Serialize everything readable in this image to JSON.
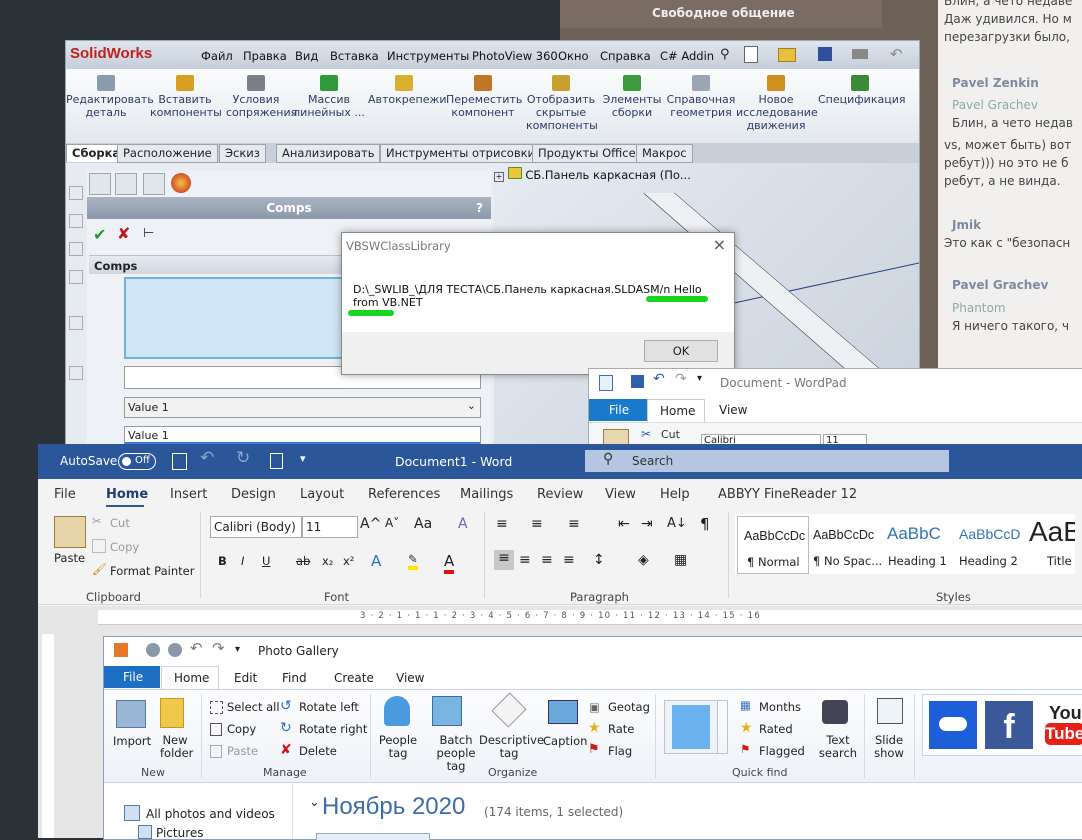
{
  "telegram": {
    "top_text": "Свободное общение",
    "lines": [
      "Блин, а чето недаве",
      "Даж удивился. Но м",
      "перезагрузки было,",
      "Pavel Zenkin",
      "Pavel Grachev",
      "Блин, а чето недав",
      "vs, может быть) вот",
      "ребут))) но это не б",
      "ребут, а не винда.",
      "Jmik",
      "Это как с \"безопасн",
      "Pavel Grachev",
      "Phantom",
      "Я ничего такого, ч"
    ]
  },
  "solidworks": {
    "logo": "SolidWorks",
    "menu": [
      "Файл",
      "Правка",
      "Вид",
      "Вставка",
      "Инструменты",
      "PhotoView 360",
      "Окно",
      "Справка",
      "C# Addin"
    ],
    "ribbon": [
      {
        "label": "Редактировать деталь",
        "color": "#8a9bb0"
      },
      {
        "label": "Вставить компоненты",
        "color": "#d7a020"
      },
      {
        "label": "Условия сопряжения",
        "color": "#7a8088"
      },
      {
        "label": "Массив линейных ...",
        "color": "#2f9a3a"
      },
      {
        "label": "Автокрепежи",
        "color": "#d9b030"
      },
      {
        "label": "Переместить компонент",
        "color": "#c07828"
      },
      {
        "label": "Отобразить скрытые компоненты",
        "color": "#c8a030"
      },
      {
        "label": "Элементы сборки",
        "color": "#3d9a3d"
      },
      {
        "label": "Справочная геометрия",
        "color": "#9aa6b6"
      },
      {
        "label": "Новое исследование движения",
        "color": "#d09020"
      },
      {
        "label": "Спецификация",
        "color": "#3a8a3a"
      }
    ],
    "tabs": [
      "Сборка",
      "Расположение",
      "Эскиз",
      "Анализировать",
      "Инструменты отрисовки",
      "Продукты Office",
      "Макрос"
    ],
    "panel_title": "Comps",
    "section": "Comps",
    "select_value": "Value 1",
    "list_item": "Value 1",
    "tree_item": "СБ.Панель каркасная  (По..."
  },
  "dialog": {
    "title": "VBSWClassLibrary",
    "message": "D:\\_SWLIB_\\ДЛЯ ТЕСТА\\СБ.Панель каркасная.SLDASM/n Hello from VB.NET",
    "ok": "OK"
  },
  "wordpad": {
    "title": "Document - WordPad",
    "tabs": [
      "File",
      "Home",
      "View"
    ],
    "font": "Calibri",
    "size": "11",
    "cut": "Cut"
  },
  "word": {
    "autosave": "AutoSave",
    "autosave_state": "Off",
    "title": "Document1 - Word",
    "search": "Search",
    "tabs": [
      "File",
      "Home",
      "Insert",
      "Design",
      "Layout",
      "References",
      "Mailings",
      "Review",
      "View",
      "Help",
      "ABBYY FineReader 12"
    ],
    "clipboard": {
      "paste": "Paste",
      "cut": "Cut",
      "copy": "Copy",
      "format_painter": "Format Painter",
      "group": "Clipboard"
    },
    "font": {
      "name": "Calibri (Body)",
      "size": "11",
      "group": "Font"
    },
    "paragraph_group": "Paragraph",
    "styles_group": "Styles",
    "styles": [
      {
        "preview": "AaBbCcDc",
        "name": "¶ Normal"
      },
      {
        "preview": "AaBbCcDc",
        "name": "¶ No Spac..."
      },
      {
        "preview": "AaBbC",
        "name": "Heading 1"
      },
      {
        "preview": "AaBbCcD",
        "name": "Heading 2"
      },
      {
        "preview": "AaB",
        "name": "Title"
      }
    ],
    "ruler": "3 · 2 · 1 · 1 · 1 · 2 · 3 · 4 · 5 · 6 · 7 · 8 · 9 · 10 · 11 · 12 · 13 · 14 · 15 · 16"
  },
  "photo_gallery": {
    "title": "Photo Gallery",
    "tabs": [
      "File",
      "Home",
      "Edit",
      "Find",
      "Create",
      "View"
    ],
    "new": {
      "import": "Import",
      "new_folder": "New folder",
      "group": "New"
    },
    "manage": {
      "select_all": "Select all",
      "copy": "Copy",
      "paste": "Paste",
      "rotate_left": "Rotate left",
      "rotate_right": "Rotate right",
      "delete": "Delete",
      "group": "Manage"
    },
    "organize": {
      "people_tag": "People tag",
      "batch": "Batch people tag",
      "descriptive": "Descriptive tag",
      "caption": "Caption",
      "geotag": "Geotag",
      "rate": "Rate",
      "flag": "Flag",
      "group": "Organize"
    },
    "quickfind": {
      "months": "Months",
      "rated": "Rated",
      "flagged": "Flagged",
      "text_search": "Text search",
      "group": "Quick find"
    },
    "slide_show": "Slide show",
    "share_icons": [
      "onedrive-icon",
      "facebook-icon",
      "youtube-icon"
    ],
    "youtube_text": [
      "You",
      "Tube"
    ],
    "nav": [
      "All photos and videos",
      "Pictures"
    ],
    "heading": "Ноябрь 2020",
    "count": "(174 items, 1 selected)"
  }
}
